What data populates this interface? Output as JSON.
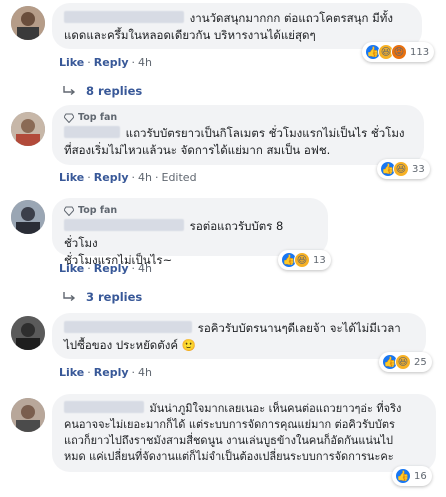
{
  "comments": [
    {
      "text": "งานวัดสนุกมากกก ต่อแถวโคตรสนุก มีทั้งแดดและครึ้มในหลอดเดียวกัน บริหารงานได้แย่สุดๆ",
      "line1": "งานวัดสนุกมากกก ต่อแถวโคตรสนุก มีทั้ง",
      "line2": "แดดและครึ้มในหลอดเดียวกัน บริหารงานได้แย่สุดๆ",
      "like": "Like",
      "reply": "Reply",
      "time": "4h",
      "reactions": [
        "like",
        "haha",
        "angry"
      ],
      "reaction_count": "113",
      "replies_label": "8 replies"
    },
    {
      "badge": "Top fan",
      "line1": "แถวรับบัตรยาวเป็นกิโลเมตร ชั่วโมงแรกไม่เป็นไร ชั่วโมง",
      "line2": "ที่สองเริ่มไม่ไหวแล้วนะ จัดการได้แย่มาก สมเป็น อฟช.",
      "like": "Like",
      "reply": "Reply",
      "time": "4h",
      "edited": "Edited",
      "reactions": [
        "like",
        "haha"
      ],
      "reaction_count": "33"
    },
    {
      "badge": "Top fan",
      "line1": "รอต่อแถวรับบัตร 8 ชั่วโมง",
      "line2": "ชั่วโมงแรกไม่เป็นไร~",
      "like": "Like",
      "reply": "Reply",
      "time": "4h",
      "reactions": [
        "like",
        "haha"
      ],
      "reaction_count": "13",
      "replies_label": "3 replies"
    },
    {
      "line1": "รอคิวรับบัตรนานๆดีเลยจ้า จะได้ไม่มีเวลา",
      "line2": "ไปซื้อของ ประหยัดตังค์ 🙂",
      "like": "Like",
      "reply": "Reply",
      "time": "4h",
      "reactions": [
        "like",
        "haha"
      ],
      "reaction_count": "25"
    },
    {
      "line1": "มันน่าภูมิใจมากเลยเนอะ เห็นคนต่อแถวยาวๆอ่ะ ที่จริง",
      "line2": "คนอาจจะไม่เยอะมากก็ได้ แต่ระบบการจัดการคุณแย่มาก ต่อคิวรับบัตร",
      "line3": "แถวก็ยาวไปถึงราชมังสามสี่ชดนูน งานเล่นบูธข้างในคนก็อัดกันแน่นไป",
      "line4": "หมด แค่เปลี่ยนที่จัดงานแต่ก็ไม่จำเป็นต้องเปลี่ยนระบบการจัดการนะคะ",
      "reactions": [
        "like"
      ],
      "reaction_count": "16"
    }
  ],
  "colors": {
    "link": "#385898",
    "meta": "#606770",
    "bubble": "#f2f3f5",
    "like_blue": "#1877f2",
    "haha_yellow": "#f7b125",
    "angry_orange": "#e9710f"
  }
}
